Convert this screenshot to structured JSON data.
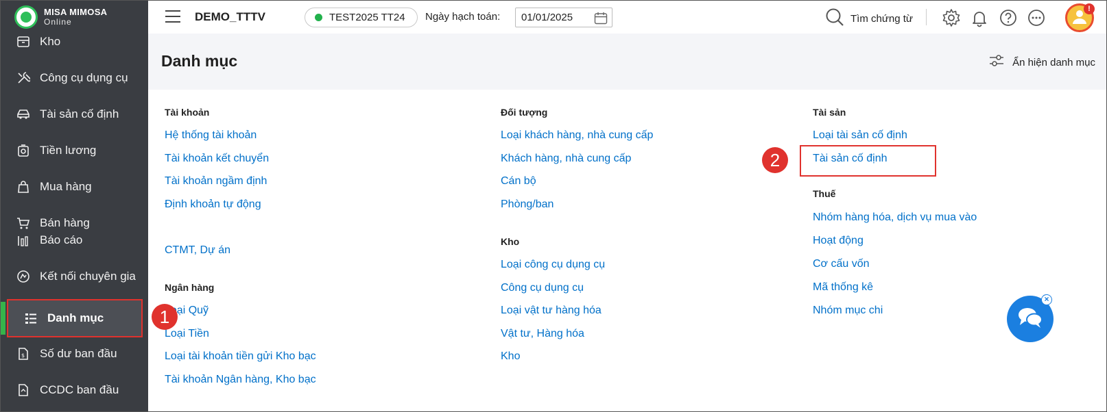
{
  "app": {
    "brand": "MISA MIMOSA",
    "sub": "Online"
  },
  "sidebar": {
    "items": [
      {
        "label": "Kho",
        "icon": "warehouse-icon"
      },
      {
        "label": "Công cụ dụng cụ",
        "icon": "tools-icon"
      },
      {
        "label": "Tài sản cố định",
        "icon": "car-icon"
      },
      {
        "label": "Tiền lương",
        "icon": "salary-icon"
      },
      {
        "label": "Mua hàng",
        "icon": "shopping-bag-icon"
      },
      {
        "label": "Bán hàng",
        "icon": "cart-icon"
      },
      {
        "label": "Báo cáo",
        "icon": "report-icon"
      },
      {
        "label": "Kết nối chuyên gia",
        "icon": "expert-icon"
      },
      {
        "label": "Danh mục",
        "icon": "catalog-icon"
      },
      {
        "label": "Số dư ban đầu",
        "icon": "balance-icon"
      },
      {
        "label": "CCDC ban đầu",
        "icon": "initial-tools-icon"
      }
    ]
  },
  "topbar": {
    "company": "DEMO_TTTV",
    "database": "TEST2025 TT24",
    "date_label": "Ngày hạch toán:",
    "date_value": "01/01/2025",
    "search_label": "Tìm chứng từ"
  },
  "page": {
    "title": "Danh mục",
    "toggle_label": "Ẩn hiện danh mục"
  },
  "sections": {
    "tai_khoan": {
      "title": "Tài khoản",
      "links": [
        "Hệ thống tài khoản",
        "Tài khoản kết chuyển",
        "Tài khoản ngầm định",
        "Định khoản tự động"
      ]
    },
    "ctmt": {
      "links": [
        "CTMT, Dự án"
      ]
    },
    "ngan_hang": {
      "title": "Ngân hàng",
      "links": [
        "Loại Quỹ",
        "Loại Tiền",
        "Loại tài khoản tiền gửi Kho bạc",
        "Tài khoản Ngân hàng, Kho bạc"
      ]
    },
    "doi_tuong": {
      "title": "Đối tượng",
      "links": [
        "Loại khách hàng, nhà cung cấp",
        "Khách hàng, nhà cung cấp",
        "Cán bộ",
        "Phòng/ban"
      ]
    },
    "kho": {
      "title": "Kho",
      "links": [
        "Loại công cụ dụng cụ",
        "Công cụ dụng cụ",
        "Loại vật tư hàng hóa",
        "Vật tư, Hàng hóa",
        "Kho"
      ]
    },
    "tai_san": {
      "title": "Tài sản",
      "links": [
        "Loại tài sản cố định",
        "Tài sản cố định"
      ]
    },
    "thue": {
      "title": "Thuế",
      "links": [
        "Nhóm hàng hóa, dịch vụ mua vào",
        "Hoạt động",
        "Cơ cấu vốn",
        "Mã thống kê",
        "Nhóm mục chi"
      ]
    }
  },
  "callouts": [
    "1",
    "2"
  ],
  "colors": {
    "link": "#0070c9",
    "sidebar": "#3a3d42",
    "highlight": "#e0322d",
    "accent": "#35b34a"
  }
}
